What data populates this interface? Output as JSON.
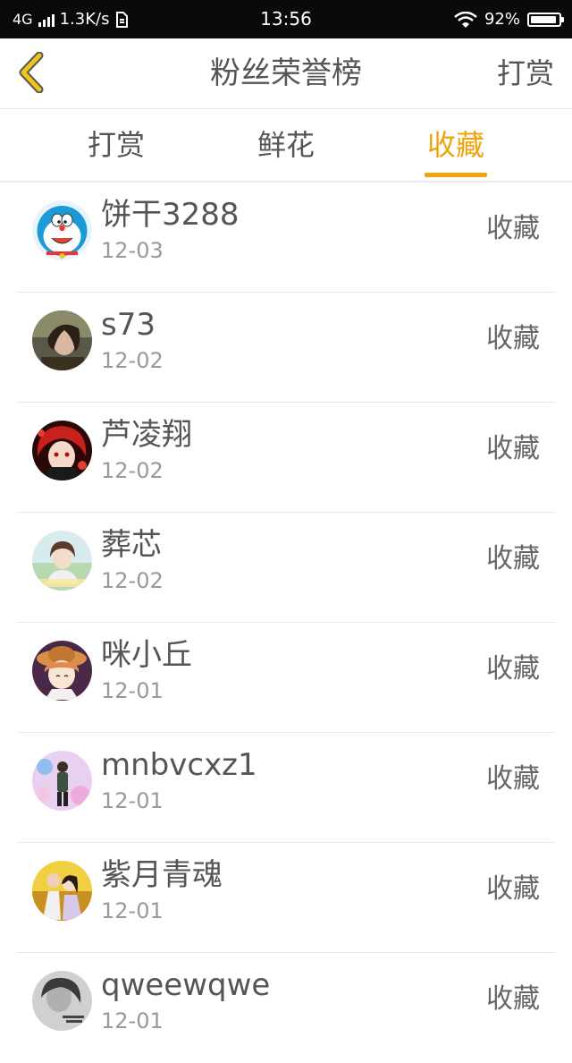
{
  "status_bar": {
    "network": "4G",
    "speed": "1.3K/s",
    "time": "13:56",
    "battery_text": "92%",
    "battery_level": 0.92
  },
  "header": {
    "title": "粉丝荣誉榜",
    "action_label": "打赏",
    "back_icon": "chevron-left-icon",
    "accent_color": "#f0c419"
  },
  "tabs": {
    "items": [
      {
        "label": "打赏",
        "active": false
      },
      {
        "label": "鲜花",
        "active": false
      },
      {
        "label": "收藏",
        "active": true
      }
    ],
    "active_color": "#f0a30a"
  },
  "list": {
    "rows": [
      {
        "name": "饼干3288",
        "date": "12-03",
        "action": "收藏",
        "avatar": "doraemon-avatar"
      },
      {
        "name": "s73",
        "date": "12-02",
        "action": "收藏",
        "avatar": "portrait-avatar"
      },
      {
        "name": "芦凌翔",
        "date": "12-02",
        "action": "收藏",
        "avatar": "anime-red-avatar"
      },
      {
        "name": "葬芯",
        "date": "12-02",
        "action": "收藏",
        "avatar": "girl-avatar"
      },
      {
        "name": "咪小丘",
        "date": "12-01",
        "action": "收藏",
        "avatar": "anime-hat-avatar"
      },
      {
        "name": "mnbvcxz1",
        "date": "12-01",
        "action": "收藏",
        "avatar": "figure-avatar"
      },
      {
        "name": "紫月青魂",
        "date": "12-01",
        "action": "收藏",
        "avatar": "couple-avatar"
      },
      {
        "name": "qweewqwe",
        "date": "12-01",
        "action": "收藏",
        "avatar": "grey-avatar"
      }
    ]
  }
}
